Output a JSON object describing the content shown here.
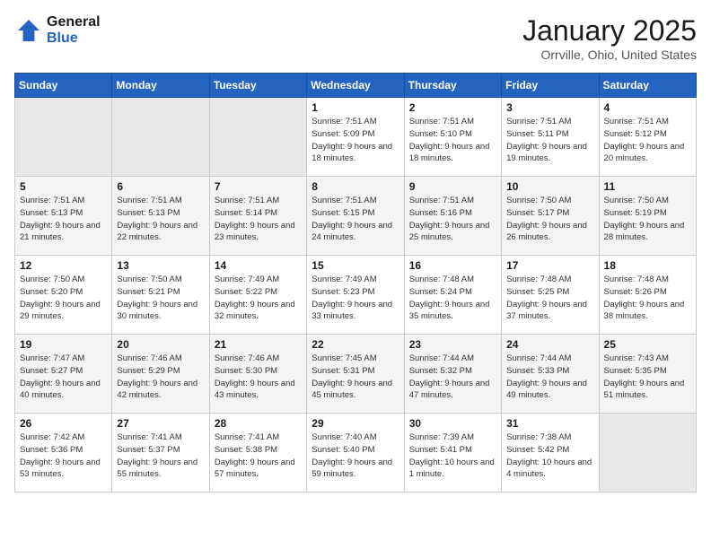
{
  "header": {
    "logo_line1": "General",
    "logo_line2": "Blue",
    "month_title": "January 2025",
    "location": "Orrville, Ohio, United States"
  },
  "weekdays": [
    "Sunday",
    "Monday",
    "Tuesday",
    "Wednesday",
    "Thursday",
    "Friday",
    "Saturday"
  ],
  "weeks": [
    [
      {
        "day": "",
        "empty": true
      },
      {
        "day": "",
        "empty": true
      },
      {
        "day": "",
        "empty": true
      },
      {
        "day": "1",
        "sunrise": "7:51 AM",
        "sunset": "5:09 PM",
        "daylight": "9 hours and 18 minutes."
      },
      {
        "day": "2",
        "sunrise": "7:51 AM",
        "sunset": "5:10 PM",
        "daylight": "9 hours and 18 minutes."
      },
      {
        "day": "3",
        "sunrise": "7:51 AM",
        "sunset": "5:11 PM",
        "daylight": "9 hours and 19 minutes."
      },
      {
        "day": "4",
        "sunrise": "7:51 AM",
        "sunset": "5:12 PM",
        "daylight": "9 hours and 20 minutes."
      }
    ],
    [
      {
        "day": "5",
        "sunrise": "7:51 AM",
        "sunset": "5:13 PM",
        "daylight": "9 hours and 21 minutes."
      },
      {
        "day": "6",
        "sunrise": "7:51 AM",
        "sunset": "5:13 PM",
        "daylight": "9 hours and 22 minutes."
      },
      {
        "day": "7",
        "sunrise": "7:51 AM",
        "sunset": "5:14 PM",
        "daylight": "9 hours and 23 minutes."
      },
      {
        "day": "8",
        "sunrise": "7:51 AM",
        "sunset": "5:15 PM",
        "daylight": "9 hours and 24 minutes."
      },
      {
        "day": "9",
        "sunrise": "7:51 AM",
        "sunset": "5:16 PM",
        "daylight": "9 hours and 25 minutes."
      },
      {
        "day": "10",
        "sunrise": "7:50 AM",
        "sunset": "5:17 PM",
        "daylight": "9 hours and 26 minutes."
      },
      {
        "day": "11",
        "sunrise": "7:50 AM",
        "sunset": "5:19 PM",
        "daylight": "9 hours and 28 minutes."
      }
    ],
    [
      {
        "day": "12",
        "sunrise": "7:50 AM",
        "sunset": "5:20 PM",
        "daylight": "9 hours and 29 minutes."
      },
      {
        "day": "13",
        "sunrise": "7:50 AM",
        "sunset": "5:21 PM",
        "daylight": "9 hours and 30 minutes."
      },
      {
        "day": "14",
        "sunrise": "7:49 AM",
        "sunset": "5:22 PM",
        "daylight": "9 hours and 32 minutes."
      },
      {
        "day": "15",
        "sunrise": "7:49 AM",
        "sunset": "5:23 PM",
        "daylight": "9 hours and 33 minutes."
      },
      {
        "day": "16",
        "sunrise": "7:48 AM",
        "sunset": "5:24 PM",
        "daylight": "9 hours and 35 minutes."
      },
      {
        "day": "17",
        "sunrise": "7:48 AM",
        "sunset": "5:25 PM",
        "daylight": "9 hours and 37 minutes."
      },
      {
        "day": "18",
        "sunrise": "7:48 AM",
        "sunset": "5:26 PM",
        "daylight": "9 hours and 38 minutes."
      }
    ],
    [
      {
        "day": "19",
        "sunrise": "7:47 AM",
        "sunset": "5:27 PM",
        "daylight": "9 hours and 40 minutes."
      },
      {
        "day": "20",
        "sunrise": "7:46 AM",
        "sunset": "5:29 PM",
        "daylight": "9 hours and 42 minutes."
      },
      {
        "day": "21",
        "sunrise": "7:46 AM",
        "sunset": "5:30 PM",
        "daylight": "9 hours and 43 minutes."
      },
      {
        "day": "22",
        "sunrise": "7:45 AM",
        "sunset": "5:31 PM",
        "daylight": "9 hours and 45 minutes."
      },
      {
        "day": "23",
        "sunrise": "7:44 AM",
        "sunset": "5:32 PM",
        "daylight": "9 hours and 47 minutes."
      },
      {
        "day": "24",
        "sunrise": "7:44 AM",
        "sunset": "5:33 PM",
        "daylight": "9 hours and 49 minutes."
      },
      {
        "day": "25",
        "sunrise": "7:43 AM",
        "sunset": "5:35 PM",
        "daylight": "9 hours and 51 minutes."
      }
    ],
    [
      {
        "day": "26",
        "sunrise": "7:42 AM",
        "sunset": "5:36 PM",
        "daylight": "9 hours and 53 minutes."
      },
      {
        "day": "27",
        "sunrise": "7:41 AM",
        "sunset": "5:37 PM",
        "daylight": "9 hours and 55 minutes."
      },
      {
        "day": "28",
        "sunrise": "7:41 AM",
        "sunset": "5:38 PM",
        "daylight": "9 hours and 57 minutes."
      },
      {
        "day": "29",
        "sunrise": "7:40 AM",
        "sunset": "5:40 PM",
        "daylight": "9 hours and 59 minutes."
      },
      {
        "day": "30",
        "sunrise": "7:39 AM",
        "sunset": "5:41 PM",
        "daylight": "10 hours and 1 minute."
      },
      {
        "day": "31",
        "sunrise": "7:38 AM",
        "sunset": "5:42 PM",
        "daylight": "10 hours and 4 minutes."
      },
      {
        "day": "",
        "empty": true
      }
    ]
  ]
}
